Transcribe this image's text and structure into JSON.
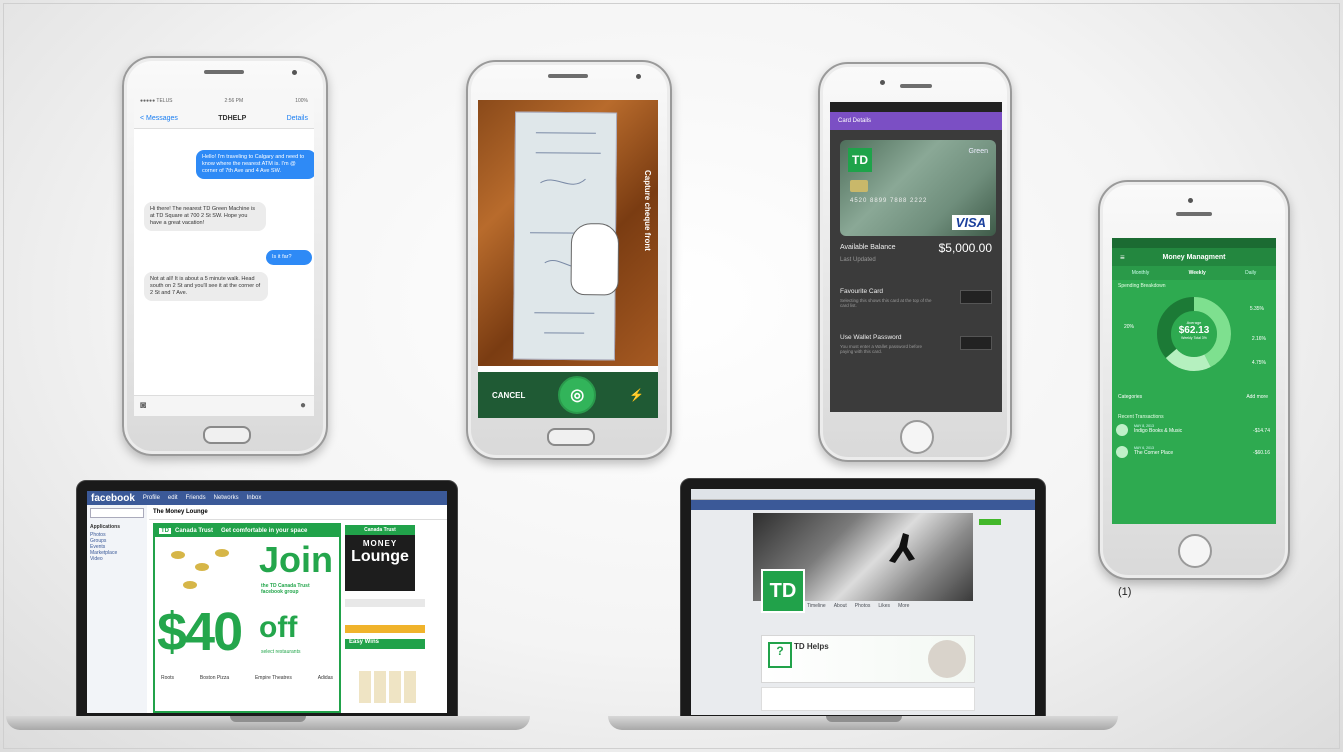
{
  "footnote": "(1)",
  "phone_messages": {
    "back": "< Messages",
    "title": "TDHELP",
    "details": "Details",
    "msg1": "Hello! I'm traveling to Calgary and need to know where the nearest ATM is. I'm @ corner of 7th Ave and 4 Ave SW.",
    "msg2": "Hi there! The nearest TD Green Machine is at TD Square at 700 2 St SW. Hope you have a great vacation!",
    "msg3": "Is it far?",
    "msg4": "Not at all! It is about a 5 minute walk. Head south on 2 St and you'll see it at the corner of 2 St and 7 Ave."
  },
  "phone_cheque": {
    "capture_label": "Capture cheque front",
    "cancel": "CANCEL",
    "camera_icon": "camera-icon",
    "flash_icon": "flash-off-icon"
  },
  "phone_card": {
    "header": "Card Details",
    "card_brand": "VISA",
    "card_logo": "TD",
    "card_tier": "Green",
    "card_number": "4520 8899 7888 2222",
    "available_label": "Available Balance",
    "available_value": "$5,000.00",
    "available_sub": "Last Updated",
    "fav_label": "Favourite Card",
    "fav_sub": "Selecting this shows this card at the top of the card list.",
    "pwd_label": "Use Wallet Password",
    "pwd_sub": "You must enter a Wallet password before paying with this card."
  },
  "phone_money": {
    "header": "Money Managment",
    "tabs": [
      "Monthly",
      "Weekly",
      "Daily"
    ],
    "section1": "Spending Breakdown",
    "center_label": "Average",
    "center_value": "$62.13",
    "center_sub": "Weekly Total 3%",
    "pct_left": "20%",
    "pct_tr": "5.35%",
    "pct_mr": "2.16%",
    "pct_br": "4.75%",
    "categories_label": "Categories",
    "add_more": "Add more",
    "section2": "Recent Transactions",
    "tx1_date": "MAY 8, 2013",
    "tx1_name": "Indigo Books & Music",
    "tx1_amt": "-$14.74",
    "tx2_date": "MAY 6, 2013",
    "tx2_name": "The Corner Place",
    "tx2_amt": "-$60.16"
  },
  "laptop_facebook": {
    "logo": "facebook",
    "nav": [
      "Profile",
      "edit",
      "Friends",
      "Networks",
      "Inbox"
    ],
    "page_title": "The Money Lounge",
    "ad_head": "Get comfortable in your space",
    "brand": "Canada Trust",
    "join": "Join",
    "join_sub": "the TD Canada Trust facebook group",
    "forty": "$40",
    "off": "off",
    "off_sub": "select restaurants",
    "lounge1": "MONEY",
    "lounge2": "Lounge",
    "easy_wins": "Easy Wins",
    "logos": [
      "Roots",
      "Boston Pizza",
      "Empire Theatres",
      "Adidas"
    ],
    "side_heading": "Applications",
    "side_items": [
      "Photos",
      "Groups",
      "Events",
      "Marketplace",
      "Video"
    ]
  },
  "laptop_td": {
    "td_logo": "TD",
    "helps_title": "TD Helps",
    "tabs": [
      "Timeline",
      "About",
      "Photos",
      "Likes",
      "More"
    ]
  }
}
